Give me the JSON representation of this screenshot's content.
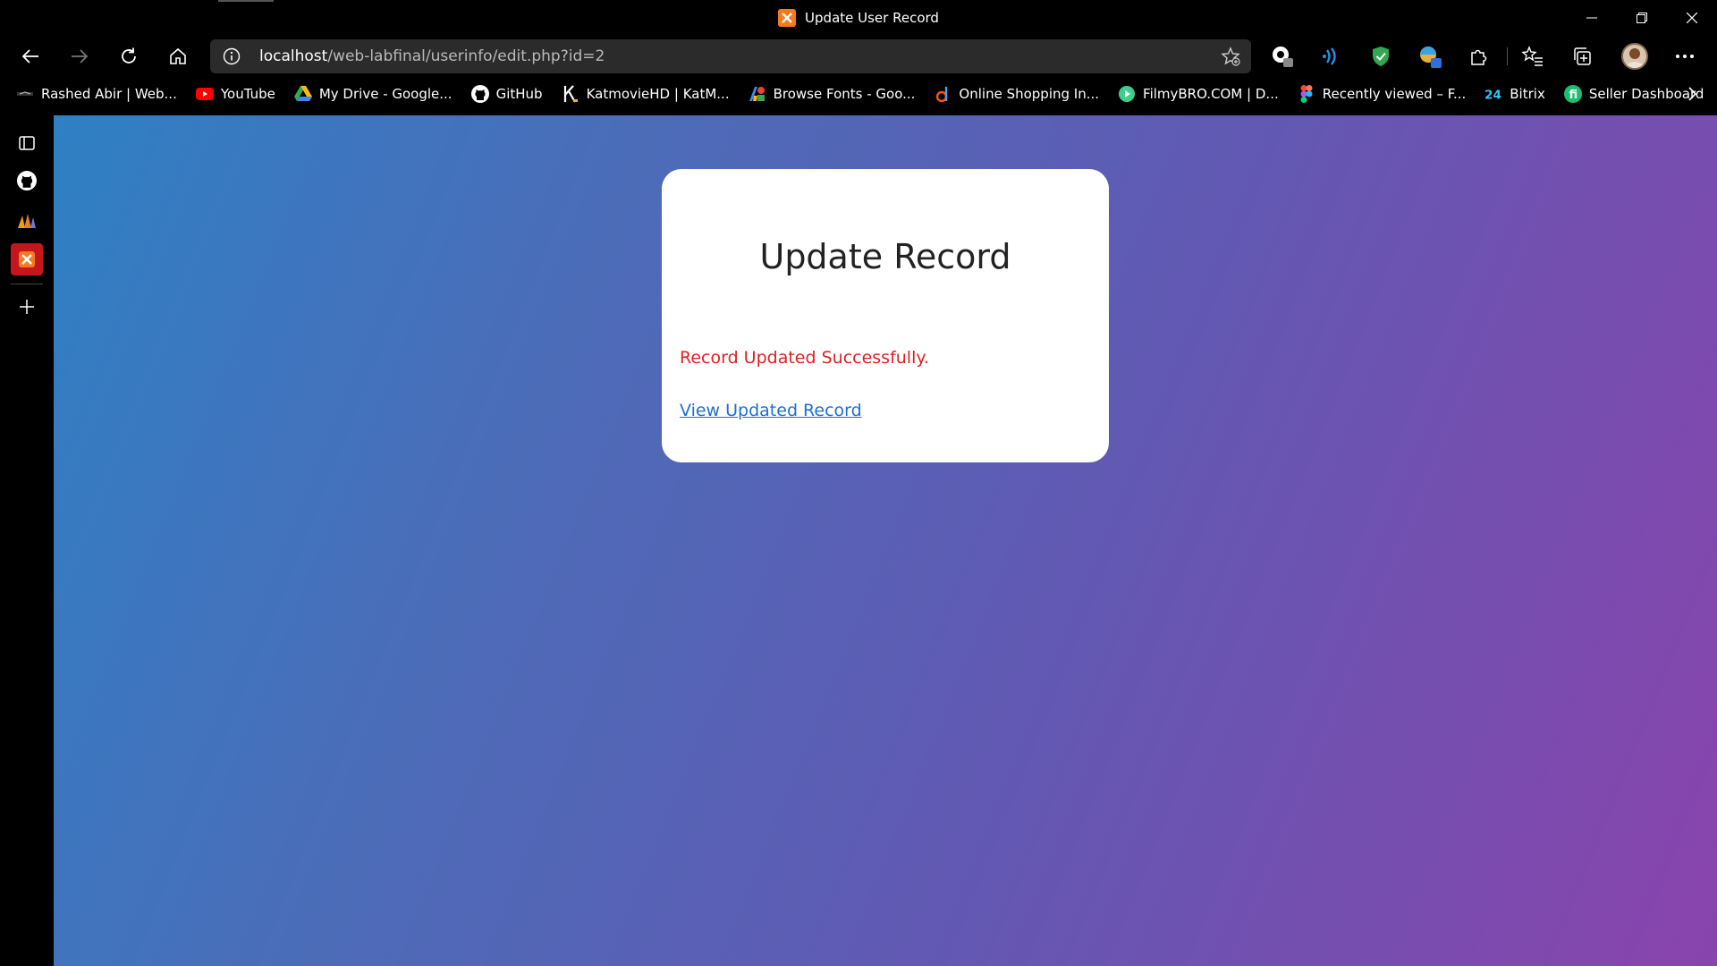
{
  "window": {
    "title": "Update User Record",
    "controls": {
      "minimize": "–",
      "restore": "❐",
      "close": "✕"
    }
  },
  "address_bar": {
    "host": "localhost",
    "path": "/web-labfinal/userinfo/edit.php?id=2"
  },
  "bookmarks": [
    {
      "label": "Rashed Abir | Web...",
      "icon": "rashed-abir-favicon"
    },
    {
      "label": "YouTube",
      "icon": "youtube-icon"
    },
    {
      "label": "My Drive - Google...",
      "icon": "google-drive-icon"
    },
    {
      "label": "GitHub",
      "icon": "github-icon"
    },
    {
      "label": "KatmovieHD | KatM...",
      "icon": "katmovie-icon"
    },
    {
      "label": "Browse Fonts - Goo...",
      "icon": "google-fonts-icon"
    },
    {
      "label": "Online Shopping In...",
      "icon": "daraz-icon"
    },
    {
      "label": "FilmyBRO.COM | D...",
      "icon": "filmybro-icon"
    },
    {
      "label": "Recently viewed – F...",
      "icon": "figma-icon"
    },
    {
      "label": "Bitrix",
      "icon": "bitrix24-icon"
    },
    {
      "label": "Seller Dashboard",
      "icon": "fiverr-icon"
    }
  ],
  "card": {
    "title": "Update Record",
    "message": "Record Updated Successfully.",
    "link": "View Updated Record"
  },
  "colors": {
    "message": "#e02020",
    "link": "#1a6fd6",
    "gradient_start": "#2f80c4",
    "gradient_end": "#8944ad",
    "tab_icon": "#f47a20",
    "sidebar_active": "#c4161c"
  }
}
